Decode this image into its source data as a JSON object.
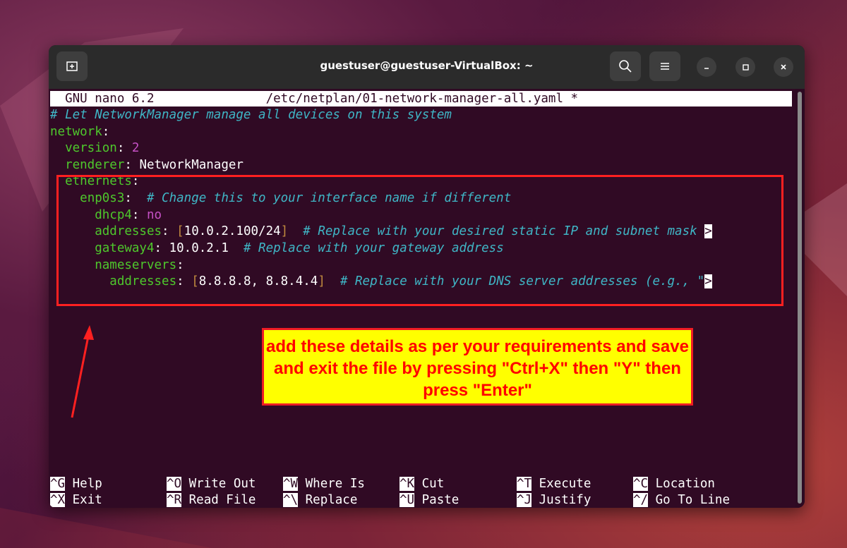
{
  "window": {
    "title": "guestuser@guestuser-VirtualBox: ~",
    "buttons": {
      "new_tab": "new-tab-icon",
      "search": "search-icon",
      "menu": "hamburger-menu-icon",
      "minimize": "minimize-icon",
      "maximize": "maximize-icon",
      "close": "close-icon"
    }
  },
  "nano": {
    "version": "GNU nano 6.2",
    "filename": "/etc/netplan/01-network-manager-all.yaml *"
  },
  "file": {
    "comment_header": "# Let NetworkManager manage all devices on this system",
    "network_key": "network",
    "version_key": "version",
    "version_value": "2",
    "renderer_key": "renderer",
    "renderer_value": "NetworkManager",
    "ethernets_key": "ethernets",
    "iface_key": "enp0s3",
    "iface_comment": "# Change this to your interface name if different",
    "dhcp4_key": "dhcp4",
    "dhcp4_value": "no",
    "addresses_key": "addresses",
    "addresses_value": "10.0.2.100/24",
    "addresses_comment": "# Replace with your desired static IP and subnet mask",
    "gateway4_key": "gateway4",
    "gateway4_value": "10.0.2.1",
    "gateway4_comment": "# Replace with your gateway address",
    "nameservers_key": "nameservers",
    "ns_addresses_key": "addresses",
    "ns_addresses_value": "8.8.8.8, 8.8.4.4",
    "ns_addresses_comment": "# Replace with your DNS server addresses (e.g., \"",
    "overflow_marker": ">"
  },
  "shortcuts": [
    {
      "key": "^G",
      "label": "Help"
    },
    {
      "key": "^O",
      "label": "Write Out"
    },
    {
      "key": "^W",
      "label": "Where Is"
    },
    {
      "key": "^K",
      "label": "Cut"
    },
    {
      "key": "^T",
      "label": "Execute"
    },
    {
      "key": "^C",
      "label": "Location"
    },
    {
      "key": "^X",
      "label": "Exit"
    },
    {
      "key": "^R",
      "label": "Read File"
    },
    {
      "key": "^\\",
      "label": "Replace"
    },
    {
      "key": "^U",
      "label": "Paste"
    },
    {
      "key": "^J",
      "label": "Justify"
    },
    {
      "key": "^/",
      "label": "Go To Line"
    }
  ],
  "annotation": {
    "text": "add these details as per your requirements and save and exit the file by pressing \"Ctrl+X\" then \"Y\" then press \"Enter\"",
    "color": "#ff0000",
    "background": "#ffff00"
  }
}
